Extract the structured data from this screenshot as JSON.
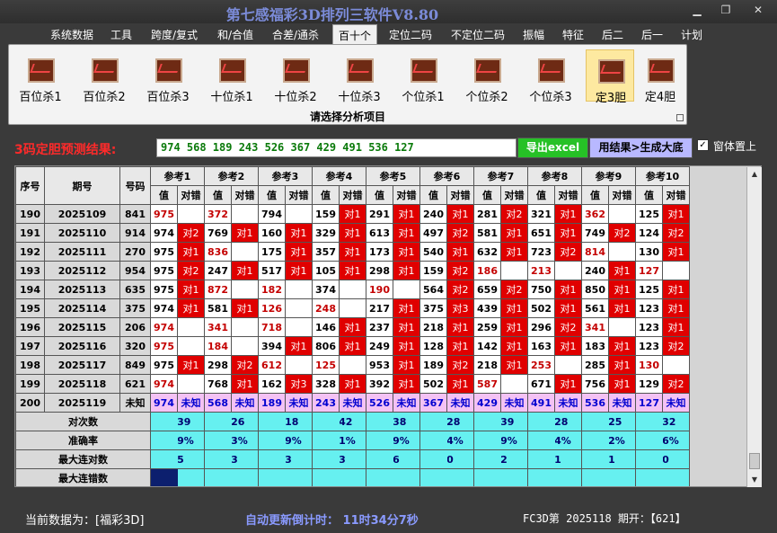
{
  "window": {
    "title": "第七感福彩3D排列三软件V8.80"
  },
  "menu": [
    "系统数据",
    "工具",
    "跨度/复式",
    "和/合值",
    "合差/通杀",
    "百十个",
    "定位二码",
    "不定位二码",
    "振幅",
    "特征",
    "后二",
    "后一",
    "计划"
  ],
  "menu_selected": "百十个",
  "ribbon": {
    "buttons": [
      "百位杀1",
      "百位杀2",
      "百位杀3",
      "十位杀1",
      "十位杀2",
      "十位杀3",
      "个位杀1",
      "个位杀2",
      "个位杀3",
      "定3胆",
      "定4胆"
    ],
    "selected": "定3胆",
    "caption": "请选择分析项目"
  },
  "result": {
    "label": "3码定胆预测结果:",
    "value": "974 568 189 243 526 367 429 491 536 127",
    "excel_button": "导出excel",
    "apply_button": "用结果>生成大底",
    "topmost_label": "窗体置上",
    "topmost_checked": "✓"
  },
  "table": {
    "col_headers": [
      "序号",
      "期号",
      "号码"
    ],
    "ref_headers": [
      "参考1",
      "参考2",
      "参考3",
      "参考4",
      "参考5",
      "参考6",
      "参考7",
      "参考8",
      "参考9",
      "参考10"
    ],
    "sub_headers": [
      "值",
      "对错"
    ],
    "rows": [
      {
        "seq": "190",
        "issue": "2025109",
        "num": "841",
        "refs": [
          [
            "975",
            "",
            "r"
          ],
          [
            "372",
            "",
            "r"
          ],
          [
            "794",
            ""
          ],
          [
            "159",
            "对1"
          ],
          [
            "291",
            "对1"
          ],
          [
            "240",
            "对1"
          ],
          [
            "281",
            "对2"
          ],
          [
            "321",
            "对1"
          ],
          [
            "362",
            "",
            "r"
          ],
          [
            "125",
            "对1"
          ]
        ]
      },
      {
        "seq": "191",
        "issue": "2025110",
        "num": "914",
        "refs": [
          [
            "974",
            "对2"
          ],
          [
            "769",
            "对1"
          ],
          [
            "160",
            "对1"
          ],
          [
            "329",
            "对1"
          ],
          [
            "613",
            "对1"
          ],
          [
            "497",
            "对2"
          ],
          [
            "581",
            "对1"
          ],
          [
            "651",
            "对1"
          ],
          [
            "749",
            "对2"
          ],
          [
            "124",
            "对2"
          ]
        ]
      },
      {
        "seq": "192",
        "issue": "2025111",
        "num": "270",
        "refs": [
          [
            "975",
            "对1"
          ],
          [
            "836",
            "",
            "r"
          ],
          [
            "175",
            "对1"
          ],
          [
            "357",
            "对1"
          ],
          [
            "173",
            "对1"
          ],
          [
            "540",
            "对1"
          ],
          [
            "632",
            "对1"
          ],
          [
            "723",
            "对2"
          ],
          [
            "814",
            "",
            "r"
          ],
          [
            "130",
            "对1"
          ]
        ]
      },
      {
        "seq": "193",
        "issue": "2025112",
        "num": "954",
        "refs": [
          [
            "975",
            "对2"
          ],
          [
            "247",
            "对1"
          ],
          [
            "517",
            "对1"
          ],
          [
            "105",
            "对1"
          ],
          [
            "298",
            "对1"
          ],
          [
            "159",
            "对2"
          ],
          [
            "186",
            "",
            "r"
          ],
          [
            "213",
            "",
            "r"
          ],
          [
            "240",
            "对1"
          ],
          [
            "127",
            "",
            "r"
          ]
        ]
      },
      {
        "seq": "194",
        "issue": "2025113",
        "num": "635",
        "refs": [
          [
            "975",
            "对1"
          ],
          [
            "872",
            "",
            "r"
          ],
          [
            "182",
            "",
            "r"
          ],
          [
            "374",
            ""
          ],
          [
            "190",
            "",
            "r"
          ],
          [
            "564",
            "对2"
          ],
          [
            "659",
            "对2"
          ],
          [
            "750",
            "对1"
          ],
          [
            "850",
            "对1"
          ],
          [
            "125",
            "对1"
          ]
        ]
      },
      {
        "seq": "195",
        "issue": "2025114",
        "num": "375",
        "refs": [
          [
            "974",
            "对1"
          ],
          [
            "581",
            "对1"
          ],
          [
            "126",
            "",
            "r"
          ],
          [
            "248",
            "",
            "r"
          ],
          [
            "217",
            "对1"
          ],
          [
            "375",
            "对3"
          ],
          [
            "439",
            "对1"
          ],
          [
            "502",
            "对1"
          ],
          [
            "561",
            "对1"
          ],
          [
            "123",
            "对1"
          ]
        ]
      },
      {
        "seq": "196",
        "issue": "2025115",
        "num": "206",
        "refs": [
          [
            "974",
            "",
            "r"
          ],
          [
            "341",
            "",
            "r"
          ],
          [
            "718",
            "",
            "r"
          ],
          [
            "146",
            "对1"
          ],
          [
            "237",
            "对1"
          ],
          [
            "218",
            "对1"
          ],
          [
            "259",
            "对1"
          ],
          [
            "296",
            "对2"
          ],
          [
            "341",
            "",
            "r"
          ],
          [
            "123",
            "对1"
          ]
        ]
      },
      {
        "seq": "197",
        "issue": "2025116",
        "num": "320",
        "refs": [
          [
            "975",
            "",
            "r"
          ],
          [
            "184",
            "",
            "r"
          ],
          [
            "394",
            "对1"
          ],
          [
            "806",
            "对1"
          ],
          [
            "249",
            "对1"
          ],
          [
            "128",
            "对1"
          ],
          [
            "142",
            "对1"
          ],
          [
            "163",
            "对1"
          ],
          [
            "183",
            "对1"
          ],
          [
            "123",
            "对2"
          ]
        ]
      },
      {
        "seq": "198",
        "issue": "2025117",
        "num": "849",
        "refs": [
          [
            "975",
            "对1"
          ],
          [
            "298",
            "对2"
          ],
          [
            "612",
            "",
            "r"
          ],
          [
            "125",
            "",
            "r"
          ],
          [
            "953",
            "对1"
          ],
          [
            "189",
            "对2"
          ],
          [
            "218",
            "对1"
          ],
          [
            "253",
            "",
            "r"
          ],
          [
            "285",
            "对1"
          ],
          [
            "130",
            "",
            "r"
          ]
        ]
      },
      {
        "seq": "199",
        "issue": "2025118",
        "num": "621",
        "refs": [
          [
            "974",
            "",
            "r"
          ],
          [
            "768",
            "对1"
          ],
          [
            "162",
            "对3"
          ],
          [
            "328",
            "对1"
          ],
          [
            "392",
            "对1"
          ],
          [
            "502",
            "对1"
          ],
          [
            "587",
            "",
            "r"
          ],
          [
            "671",
            "对1"
          ],
          [
            "756",
            "对1"
          ],
          [
            "129",
            "对2"
          ]
        ]
      }
    ],
    "next_row": {
      "seq": "200",
      "issue": "2025119",
      "num": "未知",
      "values": [
        "974",
        "568",
        "189",
        "243",
        "526",
        "367",
        "429",
        "491",
        "536",
        "127"
      ],
      "unknown": "未知"
    },
    "stats": [
      {
        "label": "对次数",
        "values": [
          "139",
          "126",
          "118",
          "142",
          "138",
          "128",
          "139",
          "128",
          "125",
          "132"
        ]
      },
      {
        "label": "准确率",
        "values": [
          "69%",
          "63%",
          "59%",
          "71%",
          "69%",
          "64%",
          "69%",
          "64%",
          "62%",
          "66%"
        ]
      },
      {
        "label": "最大连对数",
        "values": [
          "15",
          "13",
          "13",
          "13",
          "16",
          "10",
          "12",
          "11",
          "11",
          "10"
        ]
      },
      {
        "label": "最大连错数",
        "values": [
          "6",
          "5",
          "7",
          "3",
          "3",
          "9",
          "3",
          "4",
          "4",
          "5"
        ]
      }
    ]
  },
  "status": {
    "current": "当前数据为：[福彩3D]",
    "countdown": "自动更新倒计时：  11时34分7秒",
    "info": "FC3D第 2025118 期开：【621】"
  },
  "colors": {
    "hit": "#e00000",
    "unknown_row": "#f4c2f4",
    "stats": "#66f0f0",
    "title": "#7b8bd8"
  }
}
